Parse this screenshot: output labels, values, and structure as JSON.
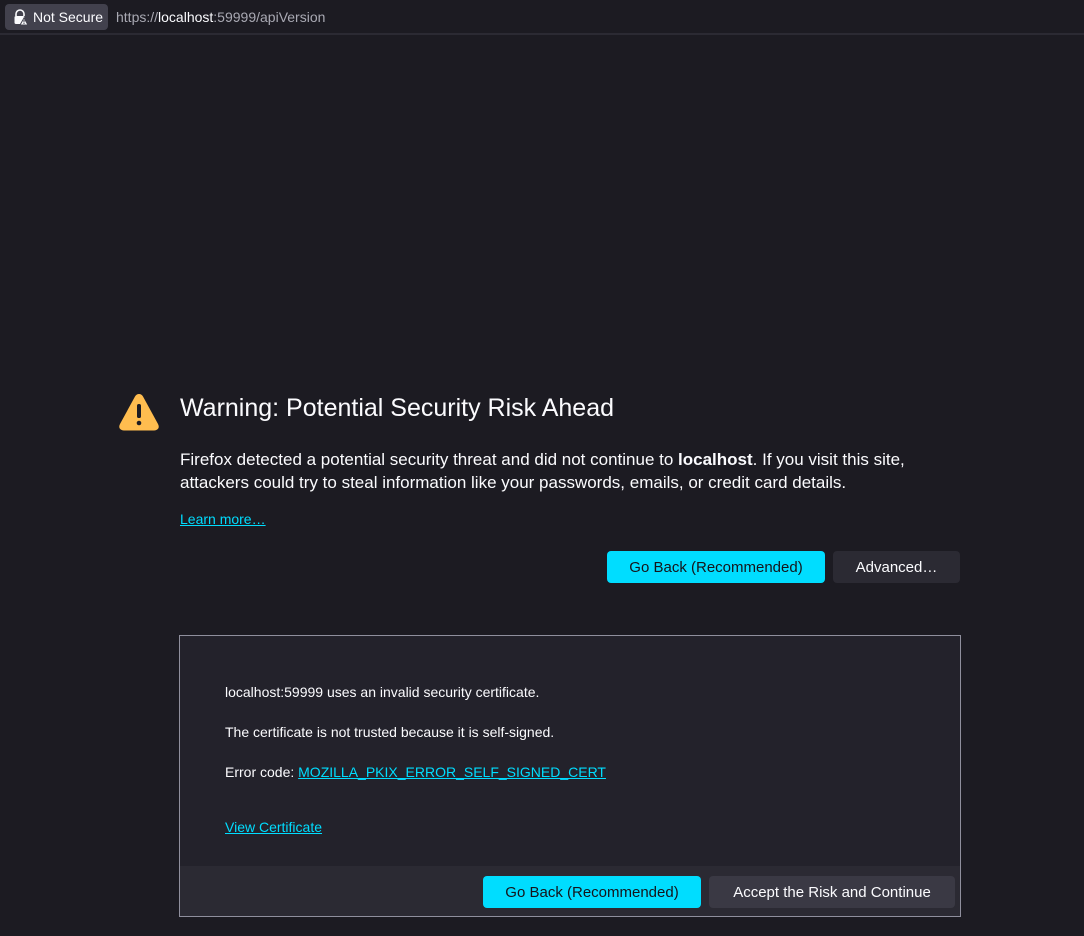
{
  "urlbar": {
    "security_label": "Not Secure",
    "url_scheme": "https://",
    "url_host": "localhost",
    "url_rest": ":59999/apiVersion"
  },
  "error_page": {
    "title": "Warning: Potential Security Risk Ahead",
    "desc_prefix": "Firefox detected a potential security threat and did not continue to ",
    "desc_host": "localhost",
    "desc_suffix": ". If you visit this site, attackers could try to steal information like your passwords, emails, or credit card details.",
    "learn_more": "Learn more…",
    "go_back_label": "Go Back (Recommended)",
    "advanced_label": "Advanced…"
  },
  "advanced_panel": {
    "line1": "localhost:59999 uses an invalid security certificate.",
    "line2": "The certificate is not trusted because it is self-signed.",
    "error_code_label": "Error code: ",
    "error_code": "MOZILLA_PKIX_ERROR_SELF_SIGNED_CERT",
    "view_certificate": "View Certificate",
    "go_back_label": "Go Back (Recommended)",
    "accept_label": "Accept the Risk and Continue"
  },
  "colors": {
    "background": "#1c1b22",
    "accent": "#00ddff",
    "warning": "#ffbd4f",
    "button_secondary": "#2b2a33"
  },
  "icons": {
    "security": "lock-warning-icon",
    "warning": "warning-triangle-icon"
  }
}
